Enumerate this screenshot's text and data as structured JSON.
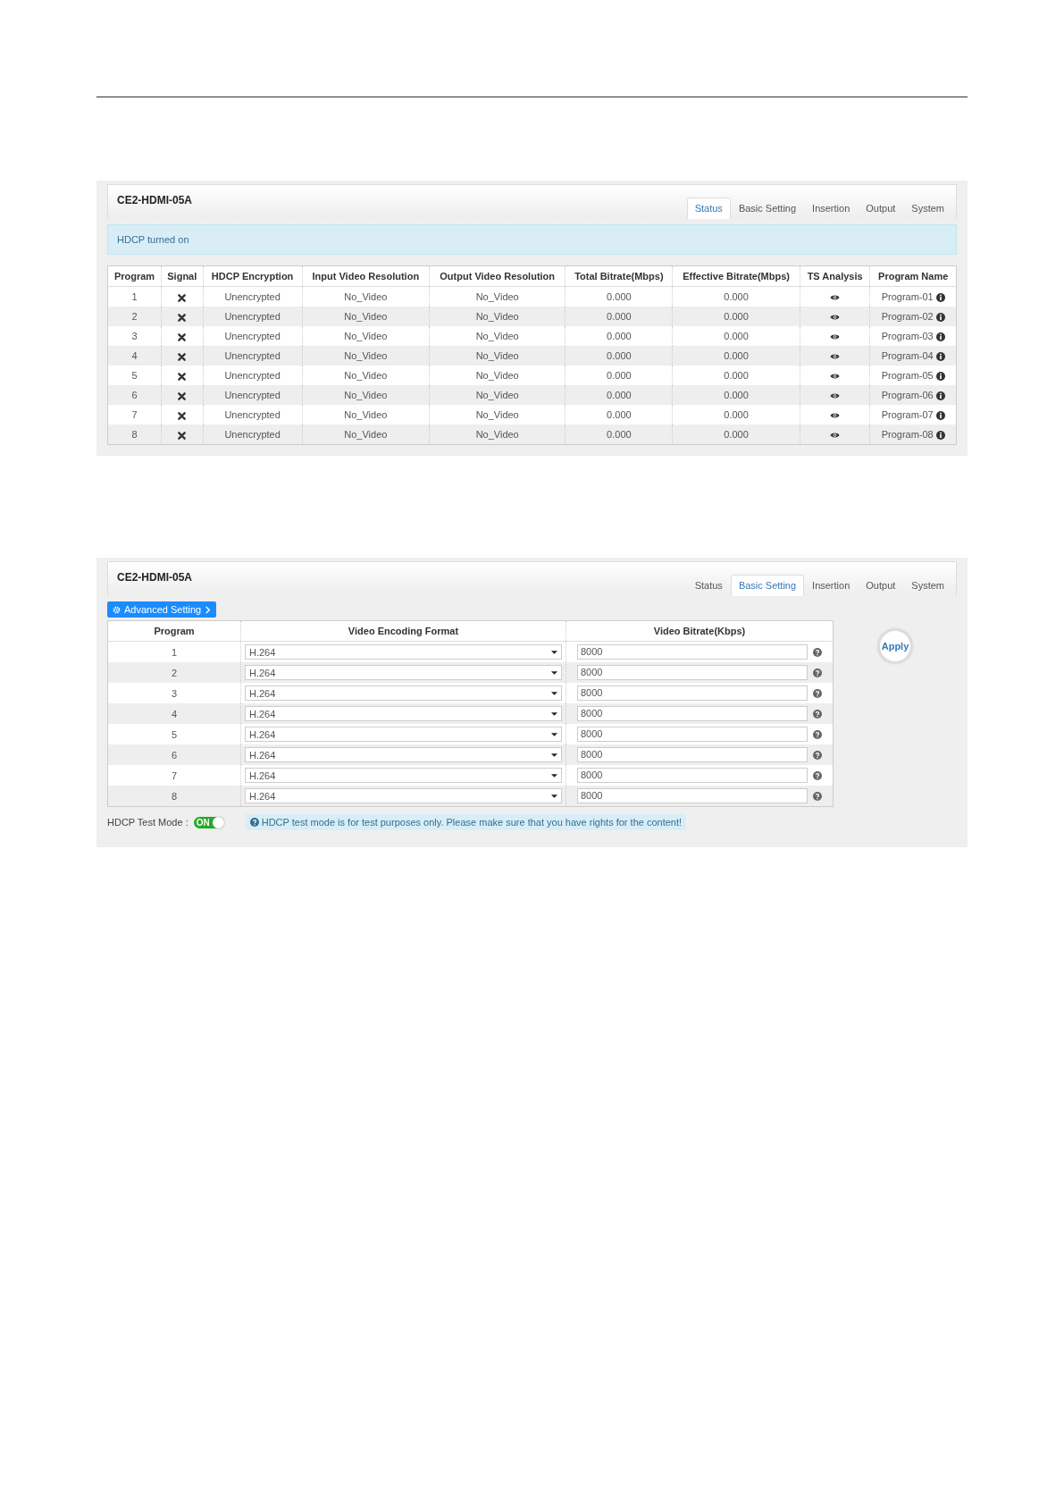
{
  "status_screen": {
    "device": "CE2-HDMI-05A",
    "tabs": [
      {
        "label": "Status",
        "selected": true
      },
      {
        "label": "Basic Setting",
        "selected": false
      },
      {
        "label": "Insertion",
        "selected": false
      },
      {
        "label": "Output",
        "selected": false
      },
      {
        "label": "System",
        "selected": false
      }
    ],
    "alert": "HDCP turned on",
    "columns": [
      "Program",
      "Signal",
      "HDCP Encryption",
      "Input Video Resolution",
      "Output Video Resolution",
      "Total Bitrate(Mbps)",
      "Effective Bitrate(Mbps)",
      "TS Analysis",
      "Program Name"
    ],
    "rows": [
      {
        "program": "1",
        "encryption": "Unencrypted",
        "input": "No_Video",
        "output": "No_Video",
        "total": "0.000",
        "effective": "0.000",
        "name": "Program-01"
      },
      {
        "program": "2",
        "encryption": "Unencrypted",
        "input": "No_Video",
        "output": "No_Video",
        "total": "0.000",
        "effective": "0.000",
        "name": "Program-02"
      },
      {
        "program": "3",
        "encryption": "Unencrypted",
        "input": "No_Video",
        "output": "No_Video",
        "total": "0.000",
        "effective": "0.000",
        "name": "Program-03"
      },
      {
        "program": "4",
        "encryption": "Unencrypted",
        "input": "No_Video",
        "output": "No_Video",
        "total": "0.000",
        "effective": "0.000",
        "name": "Program-04"
      },
      {
        "program": "5",
        "encryption": "Unencrypted",
        "input": "No_Video",
        "output": "No_Video",
        "total": "0.000",
        "effective": "0.000",
        "name": "Program-05"
      },
      {
        "program": "6",
        "encryption": "Unencrypted",
        "input": "No_Video",
        "output": "No_Video",
        "total": "0.000",
        "effective": "0.000",
        "name": "Program-06"
      },
      {
        "program": "7",
        "encryption": "Unencrypted",
        "input": "No_Video",
        "output": "No_Video",
        "total": "0.000",
        "effective": "0.000",
        "name": "Program-07"
      },
      {
        "program": "8",
        "encryption": "Unencrypted",
        "input": "No_Video",
        "output": "No_Video",
        "total": "0.000",
        "effective": "0.000",
        "name": "Program-08"
      }
    ]
  },
  "settings_screen": {
    "device": "CE2-HDMI-05A",
    "tabs": [
      {
        "label": "Status",
        "selected": false
      },
      {
        "label": "Basic Setting",
        "selected": true
      },
      {
        "label": "Insertion",
        "selected": false
      },
      {
        "label": "Output",
        "selected": false
      },
      {
        "label": "System",
        "selected": false
      }
    ],
    "advanced_button": "Advanced Setting",
    "columns": [
      "Program",
      "Video Encoding Format",
      "Video Bitrate(Kbps)"
    ],
    "rows": [
      {
        "program": "1",
        "format": "H.264",
        "bitrate": "8000"
      },
      {
        "program": "2",
        "format": "H.264",
        "bitrate": "8000"
      },
      {
        "program": "3",
        "format": "H.264",
        "bitrate": "8000"
      },
      {
        "program": "4",
        "format": "H.264",
        "bitrate": "8000"
      },
      {
        "program": "5",
        "format": "H.264",
        "bitrate": "8000"
      },
      {
        "program": "6",
        "format": "H.264",
        "bitrate": "8000"
      },
      {
        "program": "7",
        "format": "H.264",
        "bitrate": "8000"
      },
      {
        "program": "8",
        "format": "H.264",
        "bitrate": "8000"
      }
    ],
    "apply_button": "Apply",
    "hdcp_test_label": "HDCP Test Mode :",
    "hdcp_test_toggle": {
      "on": true,
      "label": "ON"
    },
    "note": "HDCP test mode is for test purposes only. Please make sure that you have rights for the content!"
  }
}
